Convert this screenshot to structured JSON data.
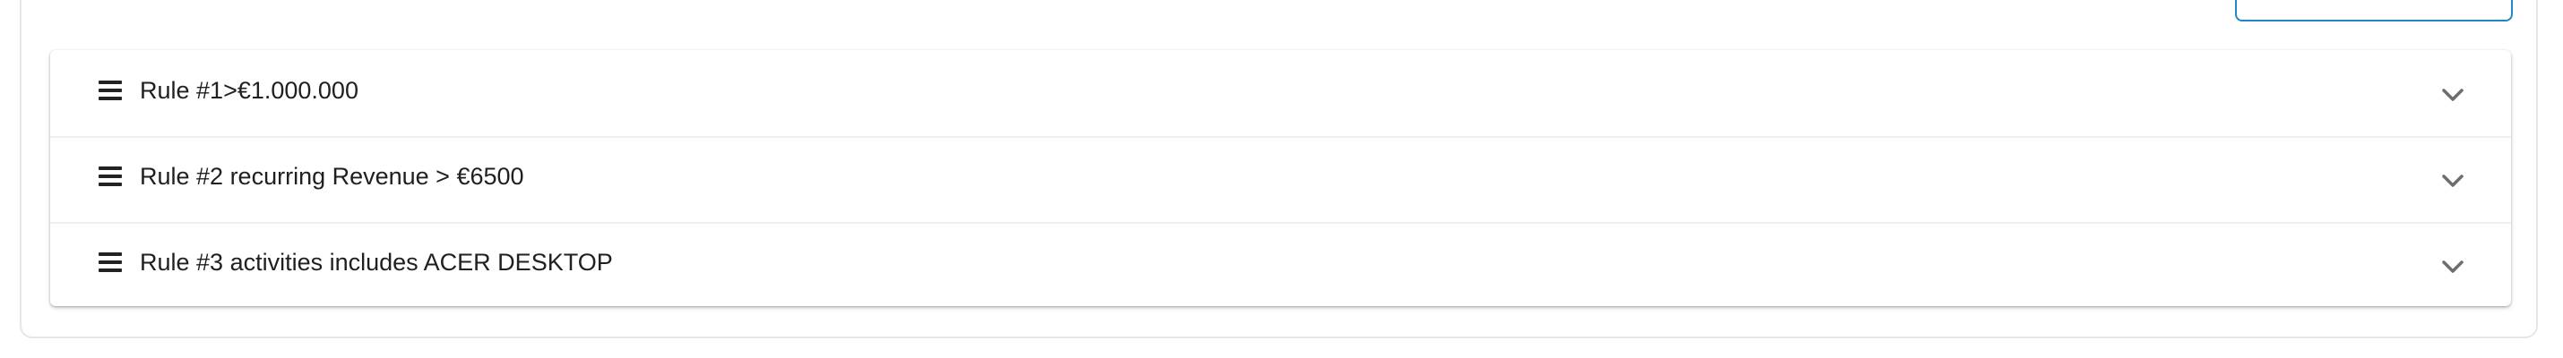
{
  "rules": [
    {
      "label": "Rule #1>€1.000.000"
    },
    {
      "label": "Rule #2 recurring Revenue > €6500"
    },
    {
      "label": "Rule #3 activities includes ACER DESKTOP"
    }
  ],
  "icons": {
    "drag": "drag-handle-icon",
    "expand": "chevron-down-icon"
  },
  "colors": {
    "accent": "#1e88c8",
    "text": "#202020",
    "chevron": "#6d6d6d"
  }
}
